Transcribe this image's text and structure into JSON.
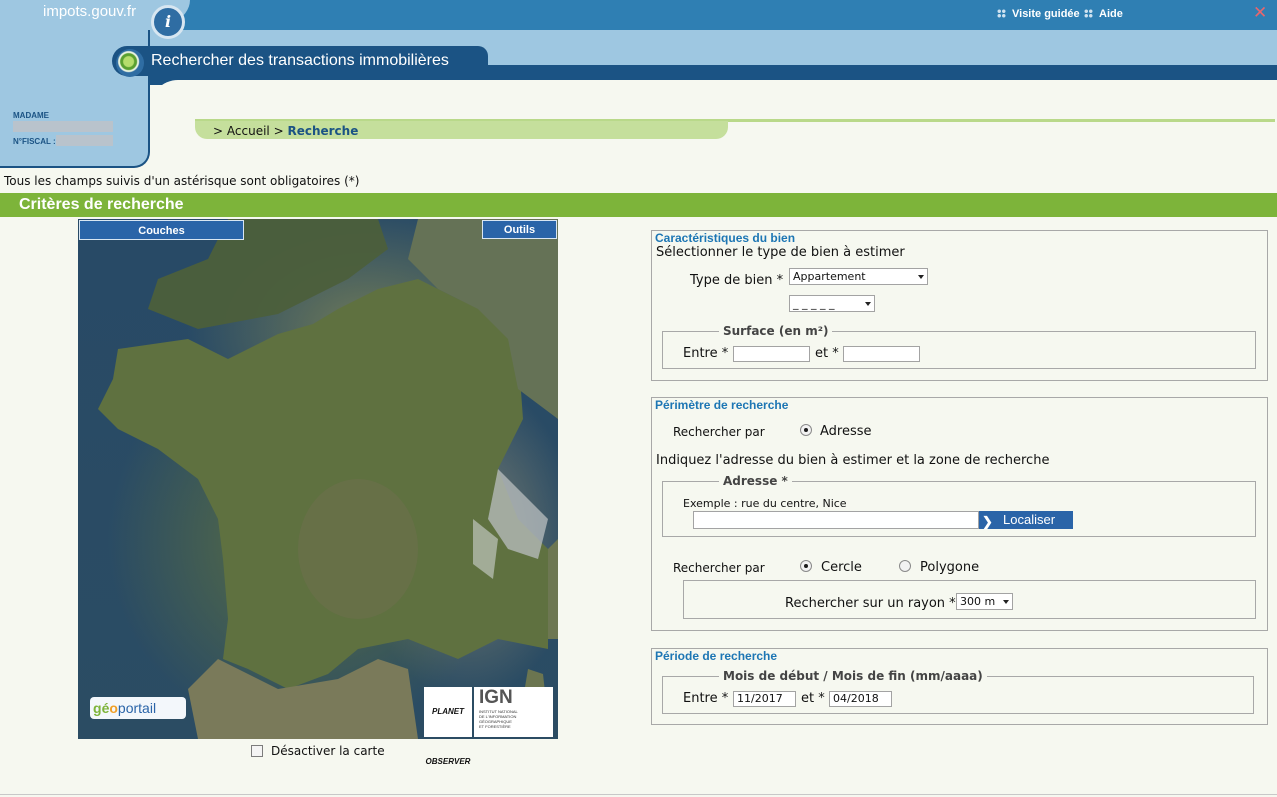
{
  "header": {
    "brand": "impots.gouv.fr",
    "brand_logo": "i",
    "links": {
      "guided_tour": "Visite guidée",
      "help": "Aide"
    },
    "close_icon": "close-icon",
    "page_title": "Rechercher des transactions immobilières"
  },
  "user": {
    "title_label": "MADAME",
    "fiscal_label": "N°FISCAL :"
  },
  "breadcrumb": {
    "prefix": ">",
    "home": "Accueil",
    "separator": ">",
    "current": "Recherche"
  },
  "required_note": "Tous les champs suivis d'un astérisque sont obligatoires (*)",
  "section_title": "Critères de recherche",
  "map": {
    "layers_button": "Couches",
    "tools_button": "Outils",
    "geoportail_logo": {
      "g": "g",
      "e": "é",
      "o": "o",
      "rest": "portail"
    },
    "planet_logo": "PLANET OBSERVER",
    "ign_logo": {
      "name": "IGN",
      "sub1": "INSTITUT NATIONAL",
      "sub2": "DE L'INFORMATION",
      "sub3": "GÉOGRAPHIQUE",
      "sub4": "ET FORESTIÈRE"
    },
    "disable_label": "Désactiver la carte",
    "disable_checked": false
  },
  "characteristics": {
    "legend": "Caractéristiques du bien",
    "intro": "Sélectionner le type de bien à estimer",
    "type_label": "Type de bien *",
    "type_value": "Appartement",
    "subtype_value": "_ _ _ _ _",
    "surface_legend": "Surface (en m²)",
    "surface_from_label": "Entre *",
    "surface_to_label": "et *",
    "surface_from": "",
    "surface_to": ""
  },
  "perimeter": {
    "legend": "Périmètre de recherche",
    "search_by_label": "Rechercher par",
    "search_by_option": "Adresse",
    "address_intro": "Indiquez l'adresse du bien à estimer et la zone de recherche",
    "address_legend": "Adresse *",
    "address_example": "Exemple : rue du centre, Nice",
    "address_value": "",
    "locate_button": "Localiser",
    "zone_label": "Rechercher par",
    "zone_options": [
      "Cercle",
      "Polygone"
    ],
    "zone_selected": "Cercle",
    "radius_label": "Rechercher sur un rayon *",
    "radius_value": "300 m"
  },
  "period": {
    "legend": "Période de recherche",
    "sublegend": "Mois de début / Mois de fin (mm/aaaa)",
    "from_label": "Entre *",
    "to_label": "et *",
    "from_value": "11/2017",
    "to_value": "04/2018"
  }
}
